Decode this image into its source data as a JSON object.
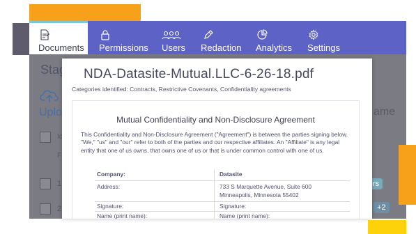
{
  "nav": {
    "tabs": [
      {
        "label": "Documents",
        "icon": "document-icon",
        "active": true
      },
      {
        "label": "Permissions",
        "icon": "lock-icon",
        "active": false
      },
      {
        "label": "Users",
        "icon": "users-icon",
        "active": false
      },
      {
        "label": "Redaction",
        "icon": "pen-icon",
        "active": false
      },
      {
        "label": "Analytics",
        "icon": "pie-chart-icon",
        "active": false
      },
      {
        "label": "Settings",
        "icon": "gear-icon",
        "active": false
      }
    ]
  },
  "background": {
    "heading": "Stag",
    "upload": "Uplo",
    "col_name": "ame",
    "row_label_1": "Ic",
    "row_label_2": "F",
    "row_num_1": "1",
    "row_num_2": "2",
    "pill_1": "rs",
    "pill_2": "+2"
  },
  "modal": {
    "title": "NDA-Datasite-Mutual.LLC-6-26-18.pdf",
    "categories": "Categories identified: Contracts, Restrictive Covenants, Confidentiality agreements",
    "agreement_title": "Mutual Confidentiality and Non-Disclosure Agreement",
    "agreement_body": "This Confidentiality and Non-Disclosure Agreement (\"Agreement\") is between the parties signing below. \"We,\" \"us\" and \"our\" refer to both of the parties and our respective affiliates. An \"Affiliate\" is any legal entity that one of us owns, that owns one of us or that is under common control with one of us.",
    "table": {
      "company_label": "Company:",
      "company_value": "Datasite",
      "address_label": "Address:",
      "address_line1": "733 S Marquette Avenue, Suite 600",
      "address_line2": "Minneapolis, Minnesota 55402",
      "signature_label": "Signature:",
      "signature_label_2": "Signature:",
      "name_label": "Name (print name):",
      "name_label_2": "Name (print name):"
    }
  },
  "colors": {
    "nav_bg": "#5d62c6",
    "accent_orange": "#f7a11a",
    "accent_yellow": "#fdd20a",
    "active_tab_accent": "#7ec7d9"
  }
}
